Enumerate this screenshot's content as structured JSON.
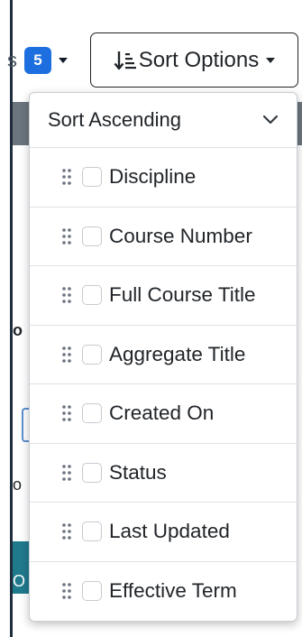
{
  "toolbar": {
    "partial_label": "s",
    "count_badge": "5",
    "sort_button_label": "Sort Options"
  },
  "background": {
    "fragment_a": "o",
    "fragment_b": "o",
    "fragment_c": "O"
  },
  "dropdown": {
    "direction": "Sort Ascending",
    "fields": [
      {
        "label": "Discipline",
        "checked": false
      },
      {
        "label": "Course Number",
        "checked": false
      },
      {
        "label": "Full Course Title",
        "checked": false
      },
      {
        "label": "Aggregate Title",
        "checked": false
      },
      {
        "label": "Created On",
        "checked": false
      },
      {
        "label": "Status",
        "checked": false
      },
      {
        "label": "Last Updated",
        "checked": false
      },
      {
        "label": "Effective Term",
        "checked": false
      }
    ]
  },
  "colors": {
    "badge": "#1d6fe0",
    "header_strip": "#6c757d",
    "accent_strip": "#1f7a8c"
  },
  "icons": {
    "sort": "sort-descending-icon",
    "caret": "caret-down-icon",
    "chevron": "chevron-down-icon",
    "handle": "grip-vertical-icon"
  }
}
